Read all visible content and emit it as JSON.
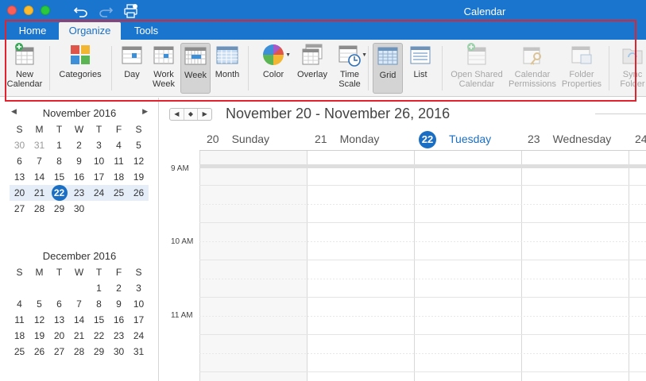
{
  "window": {
    "title": "Calendar",
    "accent": "#1a75cf",
    "highlight_color": "#e0232e"
  },
  "tabs": [
    {
      "label": "Home",
      "active": false
    },
    {
      "label": "Organize",
      "active": true
    },
    {
      "label": "Tools",
      "active": false
    }
  ],
  "ribbon": {
    "new_calendar": "New\nCalendar",
    "categories": "Categories",
    "day": "Day",
    "work_week": "Work\nWeek",
    "week": "Week",
    "month": "Month",
    "color": "Color",
    "overlay": "Overlay",
    "time_scale": "Time\nScale",
    "grid": "Grid",
    "list": "List",
    "open_shared": "Open Shared\nCalendar",
    "permissions": "Calendar\nPermissions",
    "folder_props": "Folder\nProperties",
    "sync_folders": "Sync\nFolder"
  },
  "mini_calendars": [
    {
      "title": "November 2016",
      "dow": [
        "S",
        "M",
        "T",
        "W",
        "T",
        "F",
        "S"
      ],
      "weeks": [
        [
          "30",
          "31",
          "1",
          "2",
          "3",
          "4",
          "5"
        ],
        [
          "6",
          "7",
          "8",
          "9",
          "10",
          "11",
          "12"
        ],
        [
          "13",
          "14",
          "15",
          "16",
          "17",
          "18",
          "19"
        ],
        [
          "20",
          "21",
          "22",
          "23",
          "24",
          "25",
          "26"
        ],
        [
          "27",
          "28",
          "29",
          "30",
          "",
          "",
          ""
        ]
      ]
    },
    {
      "title": "December 2016",
      "dow": [
        "S",
        "M",
        "T",
        "W",
        "T",
        "F",
        "S"
      ],
      "weeks": [
        [
          "",
          "",
          "",
          "",
          "1",
          "2",
          "3"
        ],
        [
          "4",
          "5",
          "6",
          "7",
          "8",
          "9",
          "10"
        ],
        [
          "11",
          "12",
          "13",
          "14",
          "15",
          "16",
          "17"
        ],
        [
          "18",
          "19",
          "20",
          "21",
          "22",
          "23",
          "24"
        ],
        [
          "25",
          "26",
          "27",
          "28",
          "29",
          "30",
          "31"
        ]
      ]
    }
  ],
  "main": {
    "range": "November 20 - November 26, 2016",
    "days": [
      {
        "num": "20",
        "name": "Sunday"
      },
      {
        "num": "21",
        "name": "Monday"
      },
      {
        "num": "22",
        "name": "Tuesday"
      },
      {
        "num": "23",
        "name": "Wednesday"
      },
      {
        "num": "24",
        "name": ""
      }
    ],
    "times": [
      "9 AM",
      "10 AM",
      "11 AM"
    ]
  }
}
